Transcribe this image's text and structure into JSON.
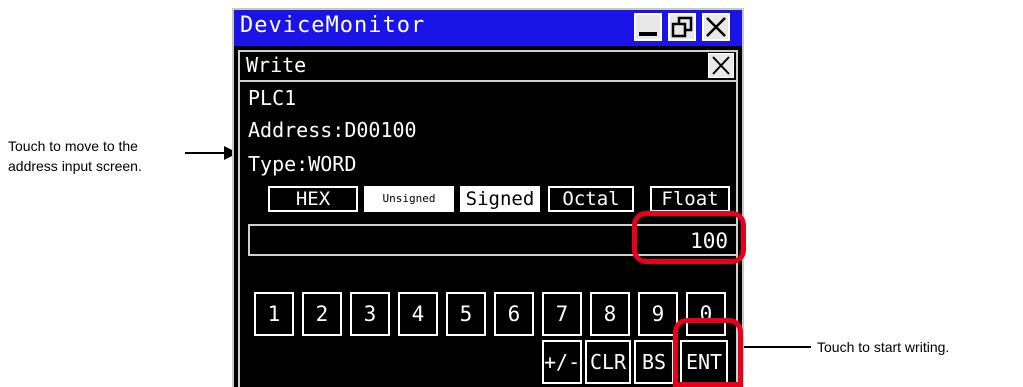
{
  "window": {
    "title": "DeviceMonitor"
  },
  "panel": {
    "title": "Write",
    "plc": "PLC1",
    "address": "Address:D00100",
    "type": "Type:WORD"
  },
  "modes": [
    "HEX",
    "Unsigned",
    "Signed",
    "Octal",
    "Float"
  ],
  "selected_mode": "Signed",
  "value": "100",
  "digits": [
    "1",
    "2",
    "3",
    "4",
    "5",
    "6",
    "7",
    "8",
    "9",
    "0"
  ],
  "functions": [
    "+/-",
    "CLR",
    "BS",
    "ENT"
  ],
  "annotations": {
    "left": "Touch to move to the address input screen.",
    "right": "Touch to start writing."
  },
  "colors": {
    "titlebar": "#1a14e6",
    "highlight": "#e8001a",
    "screen": "#000000"
  }
}
